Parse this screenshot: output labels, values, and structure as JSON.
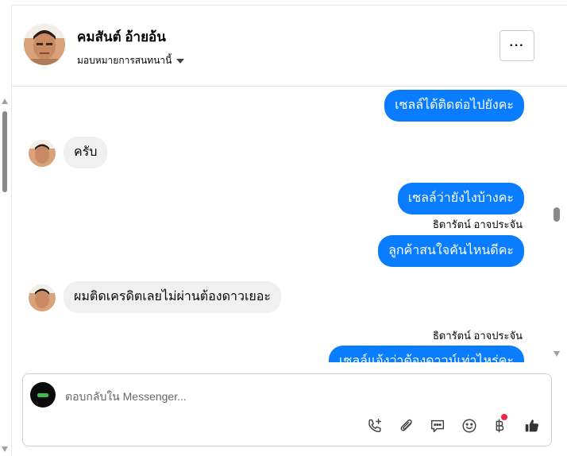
{
  "header": {
    "contact_name": "คมสันต์ อ้ายอ้น",
    "assign_label": "มอบหมายการสนทนานี้",
    "more_label": "···"
  },
  "messages": [
    {
      "direction": "out",
      "text": "เซลล์ได้ติดต่อไปยังคะ"
    },
    {
      "direction": "in",
      "text": "ครับ"
    },
    {
      "direction": "out",
      "text": "เซลล์ว่ายังไงบ้างคะ"
    },
    {
      "direction": "out",
      "sender": "ธิดารัตน์ อาจประจัน",
      "text": "ลูกค้าสนใจคันไหนดีคะ"
    },
    {
      "direction": "in",
      "text": "ผมติดเครดิตเลยไม่ผ่านต้องดาวเยอะ"
    },
    {
      "direction": "out",
      "sender": "ธิดารัตน์ อาจประจัน",
      "text": "เซลล์แจ้งว่าต้องดาวน์เท่าไหร่คะ"
    }
  ],
  "composer": {
    "placeholder": "ตอบกลับใน Messenger...",
    "tools": [
      "add-call-icon",
      "attachment-icon",
      "saved-reply-icon",
      "emoji-icon",
      "baht-payment-icon",
      "thumbs-up-icon"
    ]
  },
  "colors": {
    "outgoing_bubble": "#0a7cff",
    "incoming_bubble": "#f0f0f0",
    "notification_dot": "#f02849"
  }
}
